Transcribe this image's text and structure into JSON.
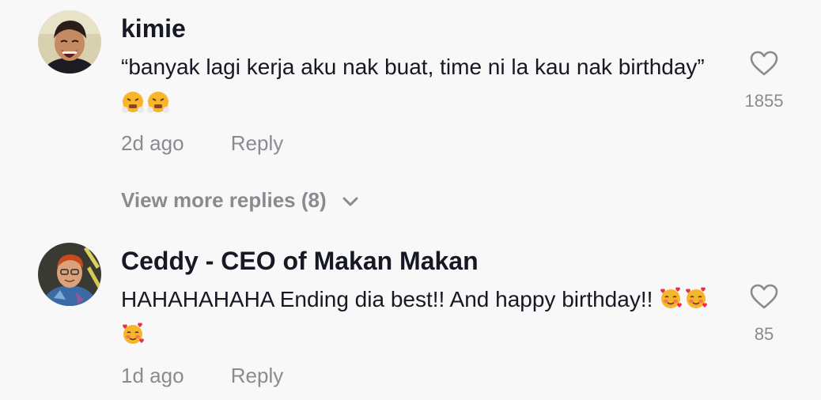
{
  "comments": [
    {
      "username": "kimie",
      "text": "“banyak lagi kerja aku nak buat, time ni la kau nak birthday”",
      "emojis": [
        "😤",
        "😤"
      ],
      "time": "2d ago",
      "reply_label": "Reply",
      "like_count": "1855"
    },
    {
      "username": "Ceddy - CEO of Makan Makan",
      "text": "HAHAHAHAHA Ending dia best!! And happy birthday!!",
      "emojis": [
        "🥰",
        "🥰",
        "🥰"
      ],
      "time": "1d ago",
      "reply_label": "Reply",
      "like_count": "85"
    }
  ],
  "view_more": {
    "label": "View more replies (8)",
    "icon": "chevron-down-icon"
  },
  "icons": {
    "like": "heart-outline-icon"
  },
  "colors": {
    "background": "#f8f8f8",
    "text": "#161823",
    "muted": "#8a8b91"
  }
}
